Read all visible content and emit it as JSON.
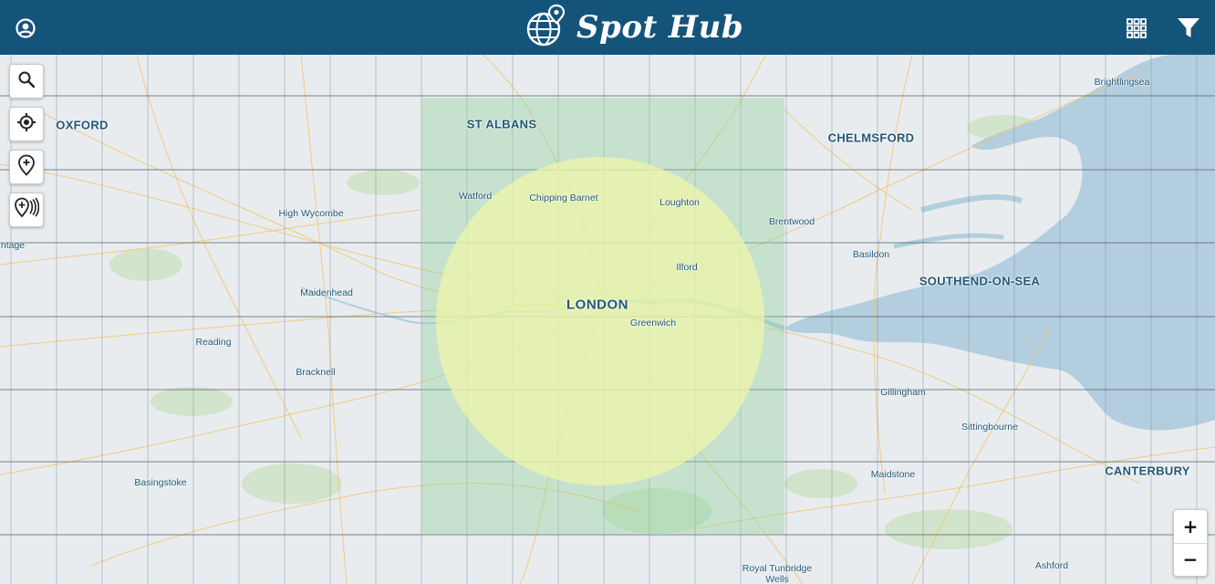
{
  "app": {
    "title": "Spot Hub"
  },
  "icons": {
    "profile": "profile-icon",
    "logo": "globe-pin-icon",
    "grid": "grid-icon",
    "filter": "filter-icon",
    "search": "search-icon",
    "locate": "locate-icon",
    "add_pin": "add-pin-icon",
    "add_area": "add-area-icon"
  },
  "colors": {
    "header": "#15547a",
    "region_fill": "#9fd8a0",
    "circle_fill": "#f1f6a8",
    "water": "#b3cede",
    "roads": "#f3c56b"
  },
  "zoom": {
    "in_label": "+",
    "out_label": "−"
  },
  "places": {
    "oxford": "OXFORD",
    "st_albans": "ST ALBANS",
    "chelmsford": "CHELMSFORD",
    "brightlingsea": "Brightlingsea",
    "watford": "Watford",
    "chipping_barnet": "Chipping Barnet",
    "loughton": "Loughton",
    "high_wycombe": "High Wycombe",
    "brentwood": "Brentwood",
    "ntage": "ntage",
    "basildon": "Basildon",
    "ilford": "Ilford",
    "southend": "SOUTHEND-ON-SEA",
    "maidenhead": "Maidenhead",
    "london": "LONDON",
    "greenwich": "Greenwich",
    "reading": "Reading",
    "bracknell": "Bracknell",
    "gillingham": "Gillingham",
    "sittingbourne": "Sittingbourne",
    "basingstoke": "Basingstoke",
    "maidstone": "Maidstone",
    "canterbury": "CANTERBURY",
    "royal_tunbridge": "Royal Tunbridge",
    "wells": "Wells",
    "ashford": "Ashford"
  }
}
